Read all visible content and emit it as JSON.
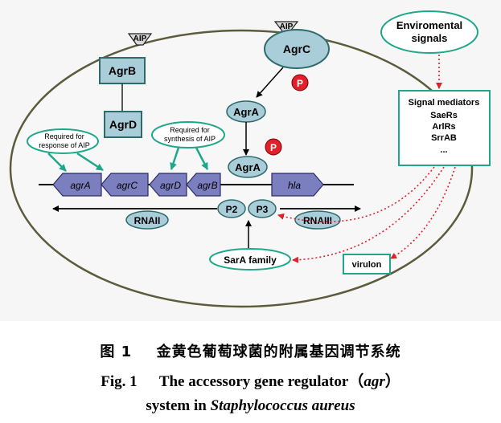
{
  "diagram": {
    "aip_top_left": "AIP",
    "aip_top_right": "AIP",
    "agrB": "AgrB",
    "agrD": "AgrD",
    "agrC": "AgrC",
    "agrA_upper": "AgrA",
    "agrA_lower": "AgrA",
    "phospho_upper": "P",
    "phospho_lower": "P",
    "note_response_1": "Required for",
    "note_response_2": "response of AIP",
    "note_synthesis_1": "Required for",
    "note_synthesis_2": "synthesis of AIP",
    "gene_agrA": "agrA",
    "gene_agrC": "agrC",
    "gene_agrD": "agrD",
    "gene_agrB": "agrB",
    "gene_hla": "hla",
    "rnaII": "RNAII",
    "rnaIII": "RNAIII",
    "p2": "P2",
    "p3": "P3",
    "sarA": "SarA family",
    "env_1": "Enviromental",
    "env_2": "signals",
    "mediators_title": "Signal mediators",
    "mediators": [
      "SaeRs",
      "ArlRs",
      "SrrAB",
      "..."
    ],
    "virulon": "virulon"
  },
  "caption": {
    "cn_label": "图 1",
    "cn_text": "金黄色葡萄球菌的附属基因调节系统",
    "en_label": "Fig.  1",
    "en_text_a": "The accessory gene regulator（",
    "en_text_italic": "agr",
    "en_text_b": "）",
    "en_line2_a": "system in ",
    "en_line2_italic": "Staphylococcus aureus"
  },
  "colors": {
    "box_fill": "#a9cdd9",
    "box_stroke": "#2e6b6b",
    "teal": "#1fa789",
    "gene_fill": "#7b7fbf",
    "phospho_red": "#e0202a",
    "dotted_red": "#e0202a"
  }
}
